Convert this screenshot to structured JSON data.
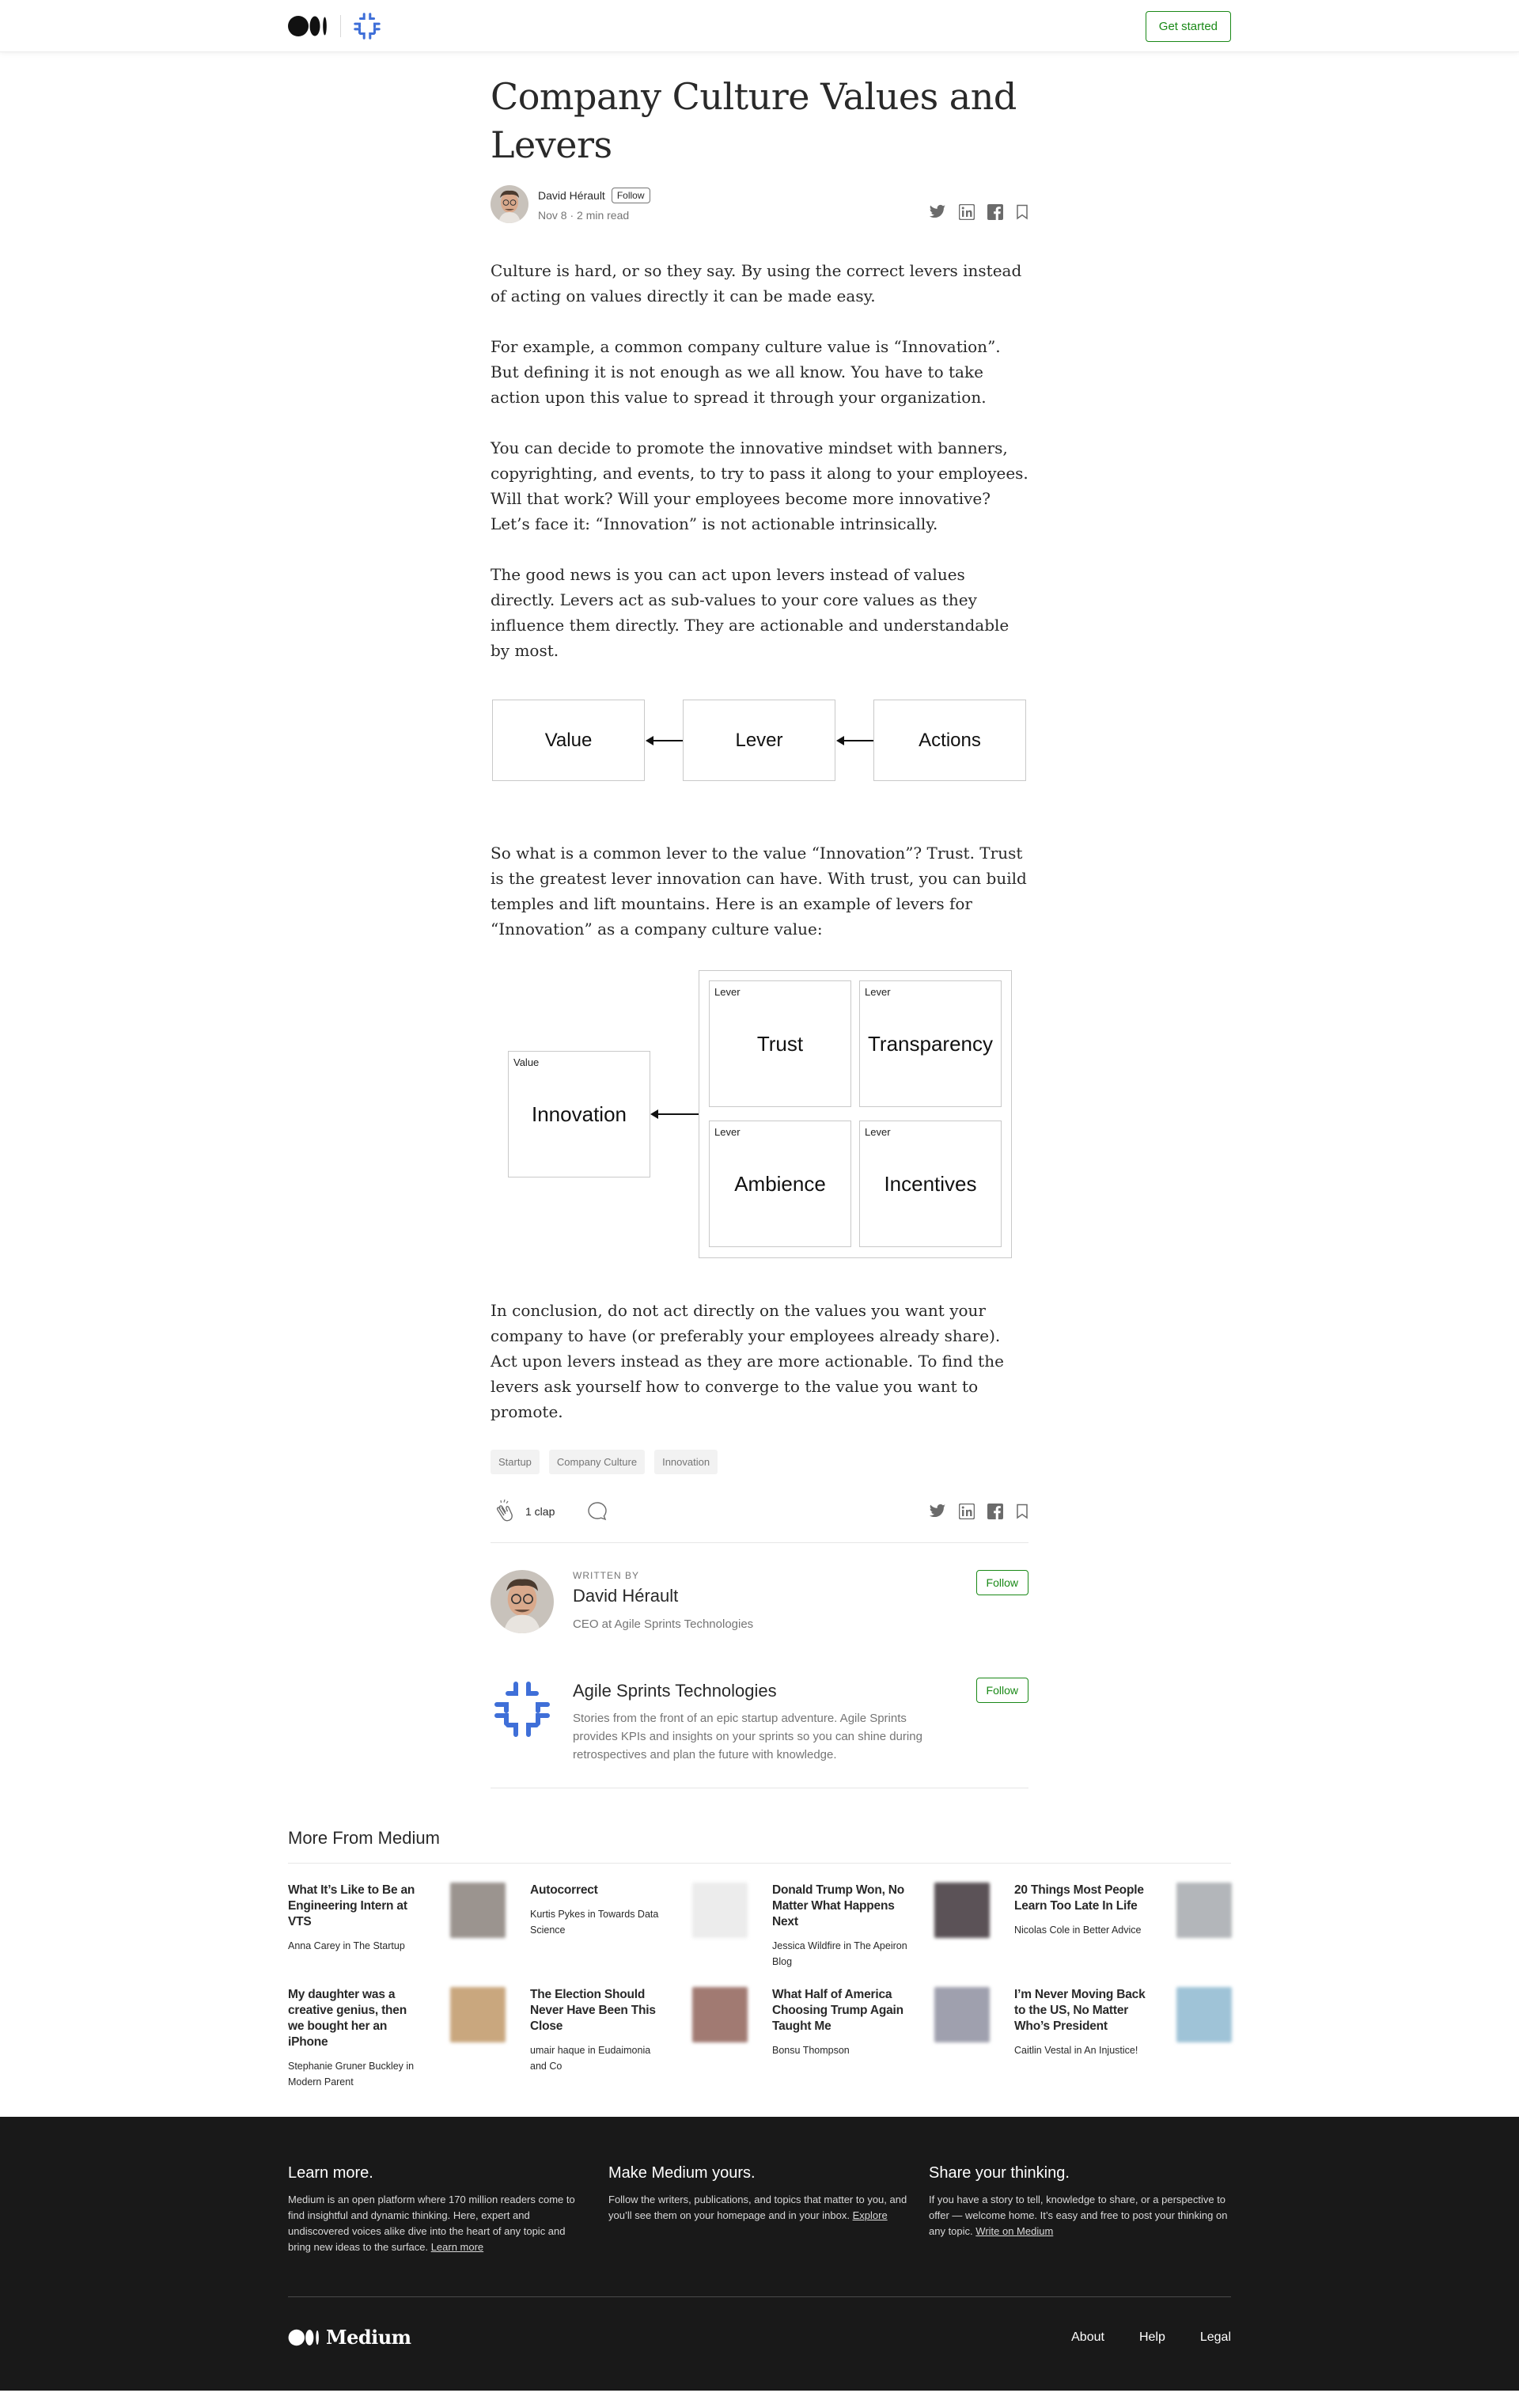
{
  "nav": {
    "get_started": "Get started"
  },
  "article": {
    "title": "Company Culture Values and Levers",
    "author": "David Hérault",
    "follow": "Follow",
    "meta": "Nov 8 · 2 min read",
    "paragraphs": [
      "Culture is hard, or so they say. By using the correct levers instead of acting on values directly it can be made easy.",
      "For example, a common company culture value is “Innovation”. But defining it is not enough as we all know. You have to take action upon this value to spread it through your organization.",
      "You can decide to promote the innovative mindset with banners, copyrighting, and events, to try to pass it along to your employees. Will that work? Will your employees become more innovative? Let’s face it: “Innovation” is not actionable intrinsically.",
      "The good news is you can act upon levers instead of values directly. Levers act as sub-values to your core values as they influence them directly. They are actionable and understandable by most.",
      "So what is a common lever to the value “Innovation”? Trust. Trust is the greatest lever innovation can have. With trust, you can build temples and lift mountains. Here is an example of levers for “Innovation” as a company culture value:",
      "In conclusion, do not act directly on the values you want your company to have (or preferably your employees already share). Act upon levers instead as they are more actionable. To find the levers ask yourself how to converge to the value you want to promote."
    ],
    "diagram1": {
      "value": "Value",
      "lever": "Lever",
      "actions": "Actions"
    },
    "diagram2": {
      "value_label": "Value",
      "value": "Innovation",
      "lever_label": "Lever",
      "levers": [
        "Trust",
        "Transparency",
        "Ambience",
        "Incentives"
      ]
    },
    "tags": [
      "Startup",
      "Company Culture",
      "Innovation"
    ],
    "claps": "1 clap"
  },
  "writer": {
    "written_by": "Written by",
    "name": "David Hérault",
    "desc": "CEO at Agile Sprints Technologies",
    "follow": "Follow"
  },
  "publication": {
    "name": "Agile Sprints Technologies",
    "desc": "Stories from the front of an epic startup adventure. Agile Sprints provides KPIs and insights on your sprints so you can shine during retrospectives and plan the future with knowledge.",
    "follow": "Follow"
  },
  "more": {
    "heading": "More From Medium",
    "cards": [
      {
        "title": "What It’s Like to Be an Engineering Intern at VTS",
        "author": "Anna Carey in The Startup",
        "color": "#9b948f"
      },
      {
        "title": "Autocorrect",
        "author": "Kurtis Pykes in Towards Data Science",
        "color": "#ececec"
      },
      {
        "title": "Donald Trump Won, No Matter What Happens Next",
        "author": "Jessica Wildfire in The Apeiron Blog",
        "color": "#5b5257"
      },
      {
        "title": "20 Things Most People Learn Too Late In Life",
        "author": "Nicolas Cole in Better Advice",
        "color": "#b3b6ba"
      },
      {
        "title": "My daughter was a creative genius, then we bought her an iPhone",
        "author": "Stephanie Gruner Buckley in Modern Parent",
        "color": "#c9a77e"
      },
      {
        "title": "The Election Should Never Have Been This Close",
        "author": "umair haque in Eudaimonia and Co",
        "color": "#a17a72"
      },
      {
        "title": "What Half of America Choosing Trump Again Taught Me",
        "author": "Bonsu Thompson",
        "color": "#9fa0ae"
      },
      {
        "title": "I’m Never Moving Back to the US, No Matter Who’s President",
        "author": "Caitlin Vestal in An Injustice!",
        "color": "#9fc3d7"
      }
    ]
  },
  "footer": {
    "col1_title": "Learn more.",
    "col1_text": "Medium is an open platform where 170 million readers come to find insightful and dynamic thinking. Here, expert and undiscovered voices alike dive into the heart of any topic and bring new ideas to the surface.",
    "col1_link": "Learn more",
    "col2_title": "Make Medium yours.",
    "col2_text": "Follow the writers, publications, and topics that matter to you, and you’ll see them on your homepage and in your inbox.",
    "col2_link": "Explore",
    "col3_title": "Share your thinking.",
    "col3_text": "If you have a story to tell, knowledge to share, or a perspective to offer — welcome home. It’s easy and free to post your thinking on any topic.",
    "col3_link": "Write on Medium",
    "brand": "Medium",
    "links": [
      "About",
      "Help",
      "Legal"
    ]
  }
}
